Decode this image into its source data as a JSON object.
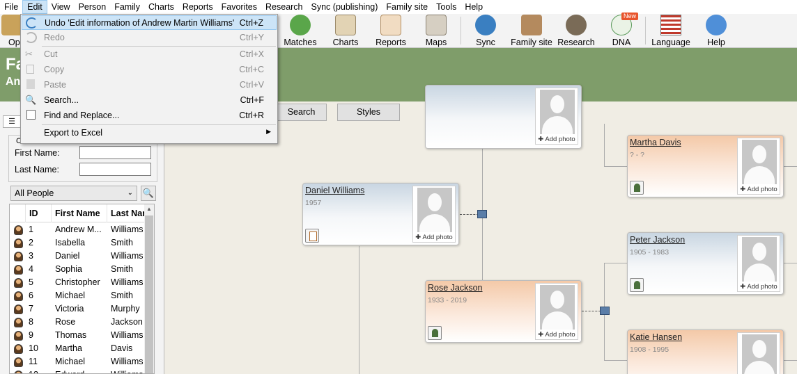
{
  "menubar": {
    "items": [
      "File",
      "Edit",
      "View",
      "Person",
      "Family",
      "Charts",
      "Reports",
      "Favorites",
      "Research",
      "Sync (publishing)",
      "Family site",
      "Tools",
      "Help"
    ]
  },
  "toolbar": {
    "partial_label": "Op",
    "buttons": [
      {
        "label": "Matches",
        "icon": "matches-icon"
      },
      {
        "label": "Charts",
        "icon": "charts-icon"
      },
      {
        "label": "Reports",
        "icon": "reports-icon"
      },
      {
        "label": "Maps",
        "icon": "maps-icon"
      },
      {
        "label": "Sync",
        "icon": "sync-icon"
      },
      {
        "label": "Family site",
        "icon": "family-site-icon"
      },
      {
        "label": "Research",
        "icon": "research-icon"
      },
      {
        "label": "DNA",
        "icon": "dna-icon"
      },
      {
        "label": "Language",
        "icon": "language-flag-icon"
      },
      {
        "label": "Help",
        "icon": "help-icon"
      }
    ],
    "new_badge": "New"
  },
  "banner": {
    "title_partial": "Fa",
    "subtitle_partial": "An"
  },
  "edit_menu": {
    "items": [
      {
        "label": "Undo 'Edit information of Andrew Martin Williams'",
        "shortcut": "Ctrl+Z"
      },
      {
        "label": "Redo",
        "shortcut": "Ctrl+Y"
      },
      {
        "label": "Cut",
        "shortcut": "Ctrl+X"
      },
      {
        "label": "Copy",
        "shortcut": "Ctrl+C"
      },
      {
        "label": "Paste",
        "shortcut": "Ctrl+V"
      },
      {
        "label": "Search...",
        "shortcut": "Ctrl+F"
      },
      {
        "label": "Find and Replace...",
        "shortcut": "Ctrl+R"
      },
      {
        "label": "Export to Excel",
        "shortcut": ""
      }
    ]
  },
  "left_panel": {
    "filter_group_label": "C",
    "first_name_label": "First Name:",
    "last_name_label": "Last Name:",
    "first_name_value": "",
    "last_name_value": "",
    "people_filter": "All People",
    "columns": [
      "ID",
      "First Name",
      "Last Nar"
    ],
    "rows": [
      {
        "id": "1",
        "first": "Andrew M...",
        "last": "Williams"
      },
      {
        "id": "2",
        "first": "Isabella",
        "last": "Smith"
      },
      {
        "id": "3",
        "first": "Daniel",
        "last": "Williams"
      },
      {
        "id": "4",
        "first": "Sophia",
        "last": "Smith"
      },
      {
        "id": "5",
        "first": "Christopher",
        "last": "Williams"
      },
      {
        "id": "6",
        "first": "Michael",
        "last": "Smith"
      },
      {
        "id": "7",
        "first": "Victoria",
        "last": "Murphy"
      },
      {
        "id": "8",
        "first": "Rose",
        "last": "Jackson"
      },
      {
        "id": "9",
        "first": "Thomas",
        "last": "Williams"
      },
      {
        "id": "10",
        "first": "Martha",
        "last": "Davis"
      },
      {
        "id": "11",
        "first": "Michael",
        "last": "Williams"
      },
      {
        "id": "12",
        "first": "Edward",
        "last": "Williams"
      }
    ]
  },
  "tree": {
    "tabs": [
      "Search",
      "Styles"
    ],
    "add_photo": "Add photo",
    "people": [
      {
        "name": "Daniel Williams",
        "dates": "1957",
        "gender": "m"
      },
      {
        "name": "Rose Jackson",
        "dates": "1933 - 2019",
        "gender": "f"
      },
      {
        "name": "Martha Davis",
        "dates": "? - ?",
        "gender": "f"
      },
      {
        "name": "Peter Jackson",
        "dates": "1905 - 1983",
        "gender": "m"
      },
      {
        "name": "Katie Hansen",
        "dates": "1908 - 1995",
        "gender": "f"
      }
    ]
  }
}
